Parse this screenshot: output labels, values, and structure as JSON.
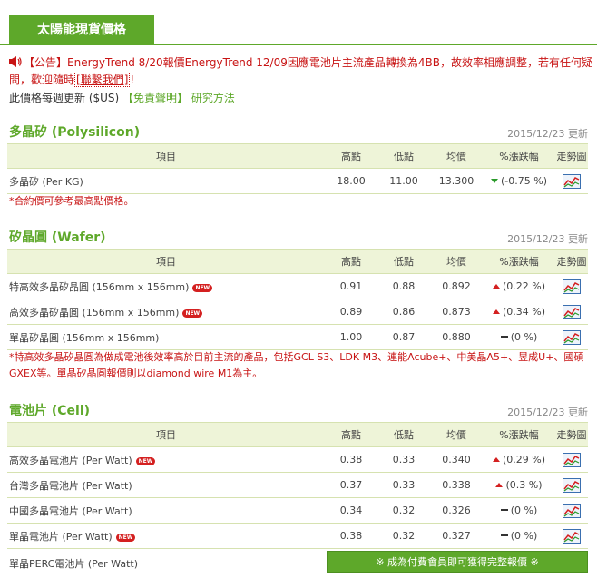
{
  "header": {
    "title": "太陽能現貨價格"
  },
  "notice": {
    "text_before": "【公告】EnergyTrend 8/20報價EnergyTrend 12/09因應電池片主流產品轉換為4BB，故效率相應調整，若有任何疑問，歡迎隨時",
    "contact_label": "[聯繫我們]",
    "text_after": "!"
  },
  "subinfo": {
    "update_text": "此價格每週更新 ($US)",
    "disclaimer_label": "【免責聲明】",
    "method_label": "研究方法"
  },
  "columns": {
    "item": "項目",
    "high": "高點",
    "low": "低點",
    "avg": "均價",
    "change": "%漲跌幅",
    "trend": "走勢圖"
  },
  "sections": {
    "poly": {
      "title": "多晶矽 (Polysilicon)",
      "date": "2015/12/23 更新",
      "rows": [
        {
          "name": "多晶矽 (Per KG)",
          "high": "18.00",
          "low": "11.00",
          "avg": "13.300",
          "change": "(-0.75 %)",
          "dir": "down",
          "new": false
        }
      ],
      "note": "*合約價可參考最高點價格。"
    },
    "wafer": {
      "title": "矽晶圓 (Wafer)",
      "date": "2015/12/23 更新",
      "rows": [
        {
          "name": "特高效多晶矽晶圓 (156mm x 156mm)",
          "high": "0.91",
          "low": "0.88",
          "avg": "0.892",
          "change": "(0.22 %)",
          "dir": "up",
          "new": true
        },
        {
          "name": "高效多晶矽晶圓 (156mm x 156mm)",
          "high": "0.89",
          "low": "0.86",
          "avg": "0.873",
          "change": "(0.34 %)",
          "dir": "up",
          "new": true
        },
        {
          "name": "單晶矽晶圓 (156mm x 156mm)",
          "high": "1.00",
          "low": "0.87",
          "avg": "0.880",
          "change": "(0 %)",
          "dir": "flat",
          "new": false
        }
      ],
      "note": "*特高效多晶矽晶圓為做成電池後效率高於目前主流的產品，包括GCL S3、LDK M3、連能Acube+、中美晶A5+、昱成U+、國碩GXEX等。單晶矽晶圓報價則以diamond wire M1為主。"
    },
    "cell": {
      "title": "電池片 (Cell)",
      "date": "2015/12/23 更新",
      "rows": [
        {
          "name": "高效多晶電池片 (Per Watt)",
          "high": "0.38",
          "low": "0.33",
          "avg": "0.340",
          "change": "(0.29 %)",
          "dir": "up",
          "new": true
        },
        {
          "name": "台灣多晶電池片 (Per Watt)",
          "high": "0.37",
          "low": "0.33",
          "avg": "0.338",
          "change": "(0.3 %)",
          "dir": "up",
          "new": false
        },
        {
          "name": "中國多晶電池片 (Per Watt)",
          "high": "0.34",
          "low": "0.32",
          "avg": "0.326",
          "change": "(0 %)",
          "dir": "flat",
          "new": false
        },
        {
          "name": "單晶電池片 (Per Watt)",
          "high": "0.38",
          "low": "0.32",
          "avg": "0.327",
          "change": "(0 %)",
          "dir": "flat",
          "new": true
        }
      ],
      "last_row_name": "單晶PERC電池片 (Per Watt)",
      "member_label": "※ 成為付費會員即可獲得完整報價 ※"
    }
  },
  "badge_label": "NEW",
  "colors": {
    "accent": "#5ea82a",
    "alert": "#c81414",
    "up": "#d42020",
    "down": "#2a9a2a"
  },
  "icons": {
    "notice": "speaker-icon",
    "trend": "trend-chart-icon"
  }
}
